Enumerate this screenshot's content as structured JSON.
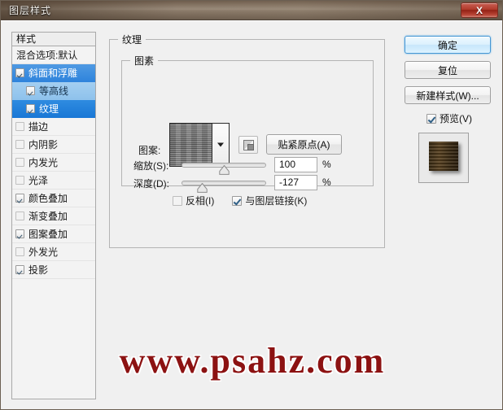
{
  "window": {
    "title": "图层样式",
    "close_label": "X"
  },
  "styles_panel": {
    "header": "样式",
    "blend_option": "混合选项:默认",
    "items": [
      {
        "label": "斜面和浮雕",
        "checked": true,
        "indent": false,
        "state": "sel-dark"
      },
      {
        "label": "等高线",
        "checked": true,
        "indent": true,
        "state": "sel-mid"
      },
      {
        "label": "纹理",
        "checked": true,
        "indent": true,
        "state": "sel-bright"
      },
      {
        "label": "描边",
        "checked": false,
        "indent": false,
        "state": "none"
      },
      {
        "label": "内阴影",
        "checked": false,
        "indent": false,
        "state": "none"
      },
      {
        "label": "内发光",
        "checked": false,
        "indent": false,
        "state": "none"
      },
      {
        "label": "光泽",
        "checked": false,
        "indent": false,
        "state": "none"
      },
      {
        "label": "颜色叠加",
        "checked": true,
        "indent": false,
        "state": "none"
      },
      {
        "label": "渐变叠加",
        "checked": false,
        "indent": false,
        "state": "none"
      },
      {
        "label": "图案叠加",
        "checked": true,
        "indent": false,
        "state": "none"
      },
      {
        "label": "外发光",
        "checked": false,
        "indent": false,
        "state": "none"
      },
      {
        "label": "投影",
        "checked": true,
        "indent": false,
        "state": "none"
      }
    ]
  },
  "texture": {
    "group_title": "纹理",
    "elements_title": "图素",
    "pattern_label": "图案:",
    "snap_button": "贴紧原点(A)",
    "scale": {
      "label": "缩放(S):",
      "value": "100",
      "unit": "%",
      "percent": 50
    },
    "depth": {
      "label": "深度(D):",
      "value": "-127",
      "unit": "%",
      "percent": 24
    },
    "invert": {
      "label": "反相(I)",
      "checked": false
    },
    "link_layer": {
      "label": "与图层链接(K)",
      "checked": true
    }
  },
  "buttons": {
    "ok": "确定",
    "reset": "复位",
    "new_style": "新建样式(W)...",
    "preview": "预览(V)",
    "preview_checked": true
  },
  "watermark": {
    "text": "www.psahz.com"
  },
  "colors": {
    "accent_selected": "#1a78d6",
    "accent_selected_mid": "#8fc2ec",
    "titlebar": "#8c7c6b",
    "close_red": "#932114",
    "watermark_red": "#8c1212",
    "dialog_bg": "#f0f0f0"
  }
}
